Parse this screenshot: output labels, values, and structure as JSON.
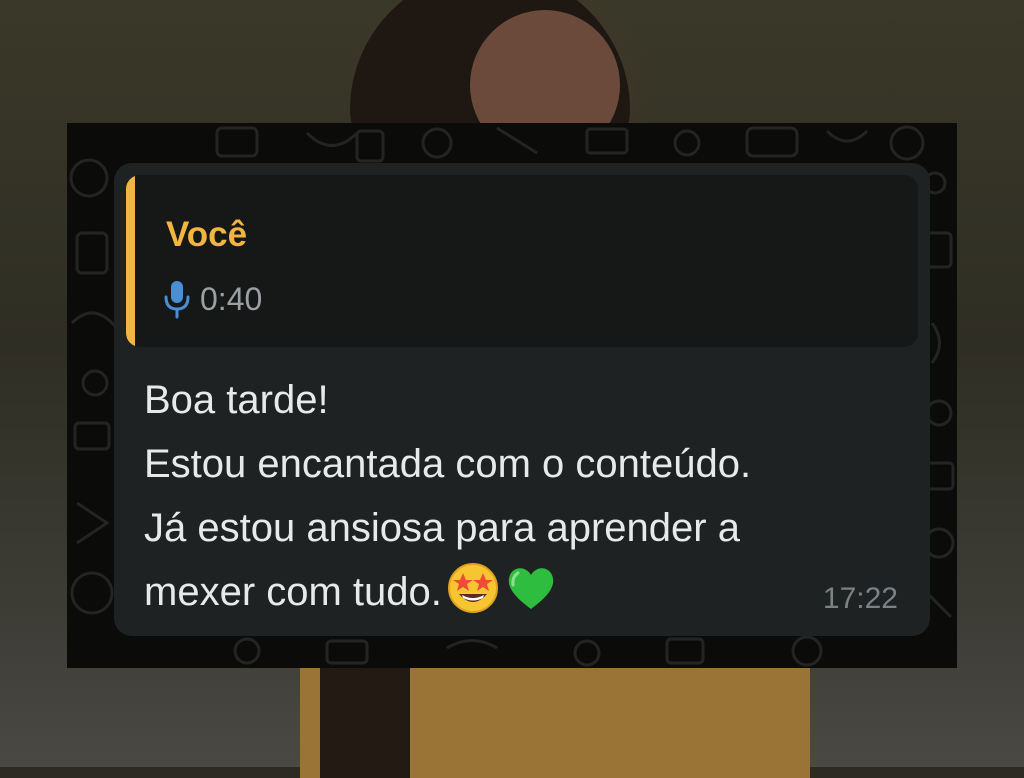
{
  "quote": {
    "author": "Você",
    "audio_icon": "microphone-icon",
    "duration": "0:40"
  },
  "message": {
    "lines": [
      "Boa tarde!",
      "Estou encantada com o conteúdo.",
      "Já estou ansiosa para aprender a",
      "mexer com tudo."
    ],
    "emojis": [
      "star-struck-emoji",
      "green-heart-emoji"
    ],
    "time": "17:22"
  },
  "colors": {
    "author": "#f2b53f",
    "mic": "#4a8fd6",
    "bubble": "#1f2223",
    "quote_bg": "#161818",
    "text": "#e8eaea",
    "time": "#7b8184"
  }
}
